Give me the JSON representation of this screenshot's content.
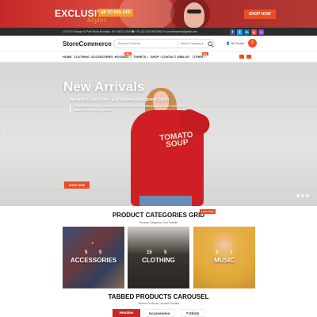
{
  "promo": {
    "title": "EXCLUSIVE",
    "offer": "UP TO 50% OFF",
    "styles": "Styles",
    "shop_now": "SHOP NOW"
  },
  "topbar": {
    "contact": "123 W 9 Orange St Park Road Brooklyn, NY 10012, USA   ☎ +01 (2) 1234 5678 900   ✉ yoursitename@gmail.com",
    "socials": [
      {
        "icon": "facebook-icon",
        "glyph": "f",
        "color": "#3b5998"
      },
      {
        "icon": "twitter-icon",
        "glyph": "t",
        "color": "#1da1f2"
      },
      {
        "icon": "linkedin-icon",
        "glyph": "in",
        "color": "#0077b5"
      },
      {
        "icon": "google-icon",
        "glyph": "g",
        "color": "#dd4b39"
      },
      {
        "icon": "instagram-icon",
        "glyph": "◎",
        "color": "#7a4bd0"
      }
    ]
  },
  "header": {
    "logo_main": "StoreCommerce",
    "logo_accent": "",
    "search_placeholder": "Search Products...",
    "search_category": "Select Category",
    "account_label": "Hi! Guest",
    "cart_count": "0"
  },
  "nav": {
    "items": [
      {
        "label": "HOME",
        "caret": ""
      },
      {
        "label": "CLOTHING",
        "caret": ""
      },
      {
        "label": "ACCESSORIES",
        "caret": "▼"
      },
      {
        "label": "HOODIES",
        "caret": "▼",
        "badge": "New"
      },
      {
        "label": "TSHIRTS",
        "caret": "▼"
      },
      {
        "label": "SHOP",
        "caret": "▼"
      },
      {
        "label": "CONTACT US",
        "caret": ""
      },
      {
        "label": "BLOG",
        "caret": ""
      },
      {
        "label": "OTHER",
        "caret": "▼",
        "badge": "Hot"
      }
    ]
  },
  "hero": {
    "sweater_line1": "TOMATO",
    "sweater_line2": "SOUP",
    "title": "New Arrivals",
    "subtitle": "Women Collection - Exclusively Designed Outfit",
    "description": "Pellentesque integer habitant penatibus eros id mus suscipit lacinia felis vivamus id duis bed turpis est dignissim!",
    "button": "SHOP NOW",
    "prev_arrow": "‹",
    "next_arrow": "›"
  },
  "categories": {
    "title": "PRODUCT CATEGORIES GRID",
    "badge": "FEATURED",
    "subtitle": "Product Categories Grid Subtitle",
    "items": [
      {
        "label": "ACCESSORIES",
        "count_a": "5",
        "count_b": "5"
      },
      {
        "label": "CLOTHING",
        "count_a": "15",
        "count_b": "5"
      },
      {
        "label": "MUSIC",
        "count_a": "2",
        "count_b": "1"
      }
    ]
  },
  "carousel": {
    "title": "TABBED PRODUCTS CAROUSEL",
    "subtitle": "Tabbed Products Carousel Subtitle",
    "tabs": [
      "Hoodies",
      "Accessories",
      "T-Shirts"
    ],
    "active_tab": "Hoodies"
  },
  "colors": {
    "accent": "#e94e26",
    "tab_active": "#c62828"
  }
}
